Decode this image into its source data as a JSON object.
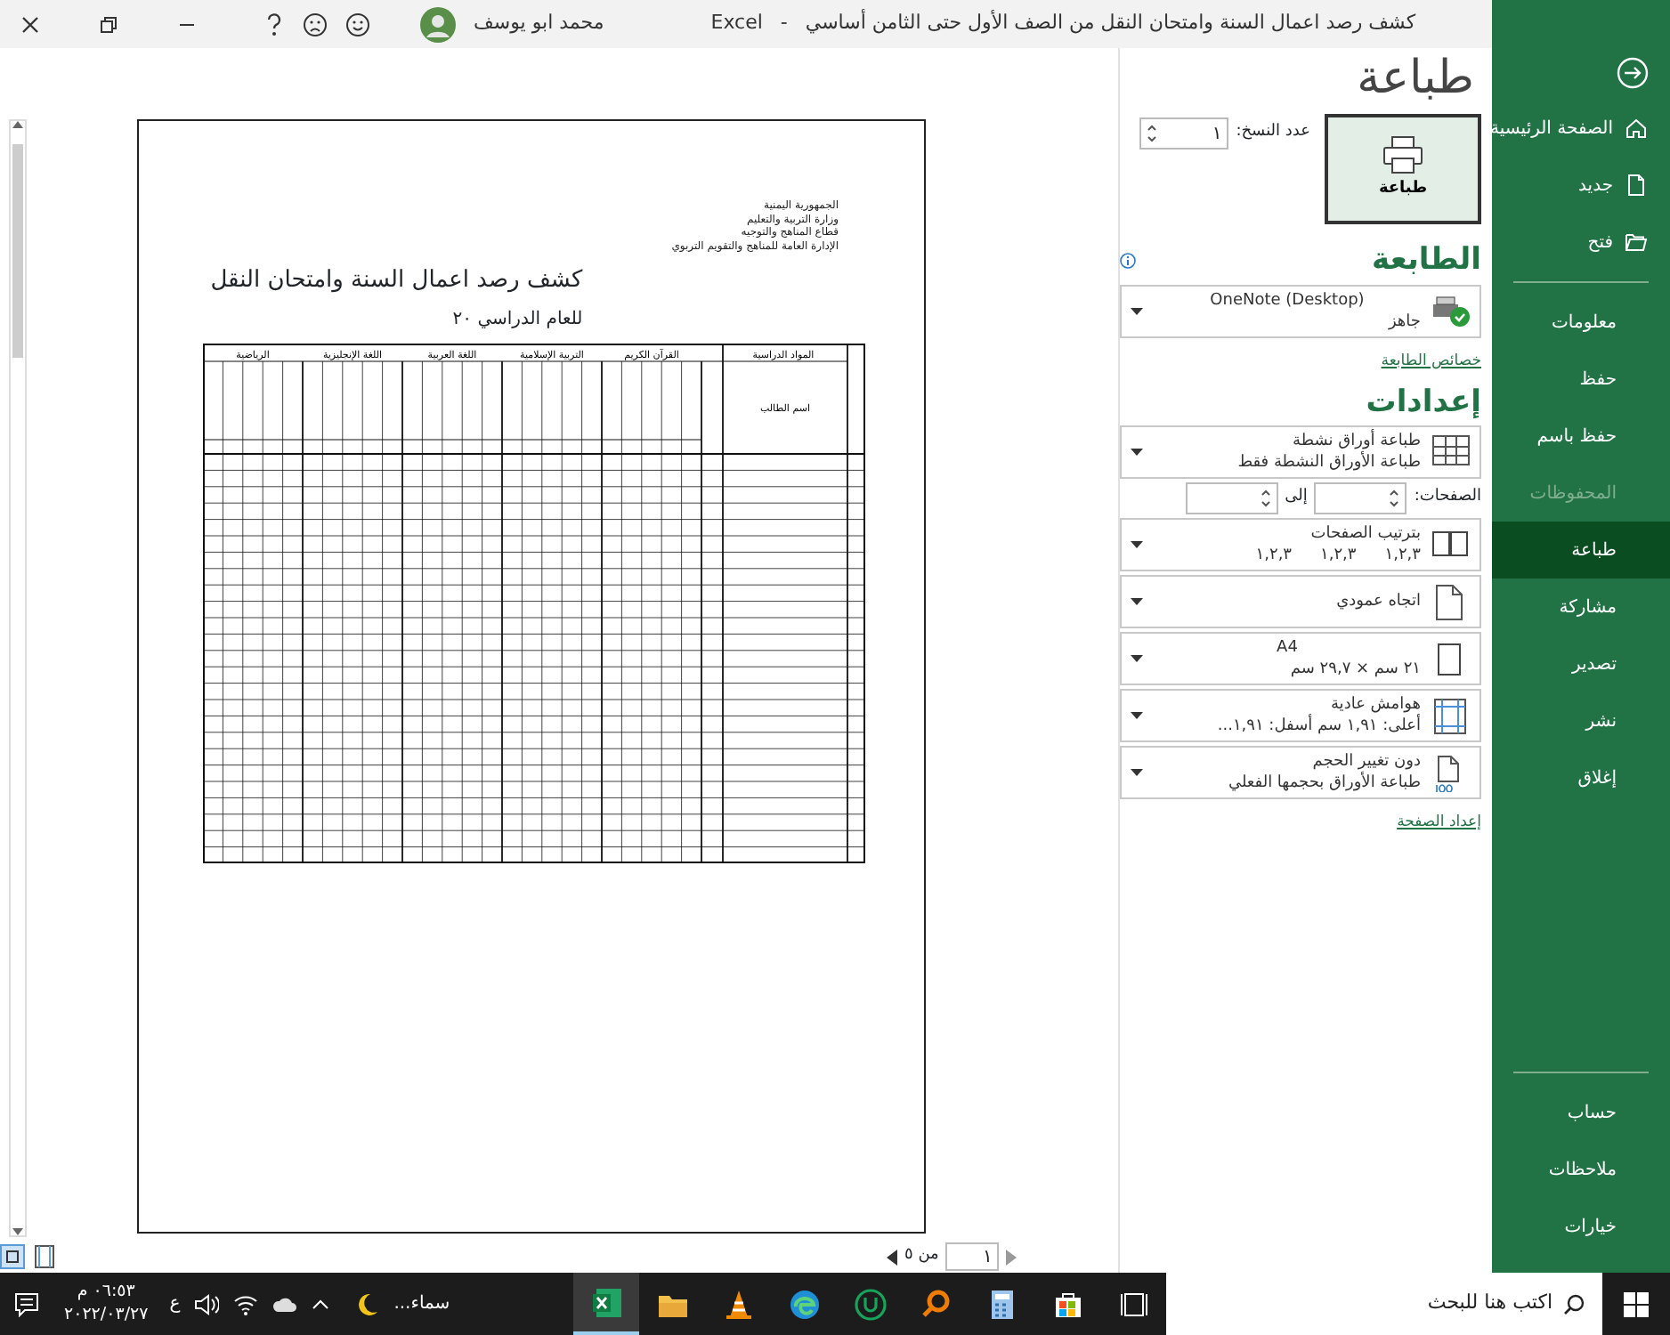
{
  "title_bar": {
    "document_title": "كشف رصد اعمال السنة وامتحان النقل من الصف الأول حتى الثامن أساسي",
    "separator": "-",
    "app": "Excel",
    "user": "محمد ابو يوسف"
  },
  "sidebar": {
    "top_items": [
      {
        "kind": "home",
        "label": "الصفحة الرئيسية",
        "selected": false
      },
      {
        "kind": "new",
        "label": "جديد",
        "selected": false
      },
      {
        "kind": "open",
        "label": "فتح",
        "selected": false
      }
    ],
    "items": [
      {
        "label": "معلومات",
        "selected": false,
        "disabled": false
      },
      {
        "label": "حفظ",
        "selected": false,
        "disabled": false
      },
      {
        "label": "حفظ باسم",
        "selected": false,
        "disabled": false
      },
      {
        "label": "المحفوظات",
        "selected": false,
        "disabled": true
      },
      {
        "label": "طباعة",
        "selected": true,
        "disabled": false
      },
      {
        "label": "مشاركة",
        "selected": false,
        "disabled": false
      },
      {
        "label": "تصدير",
        "selected": false,
        "disabled": false
      },
      {
        "label": "نشر",
        "selected": false,
        "disabled": false
      },
      {
        "label": "إغلاق",
        "selected": false,
        "disabled": false
      }
    ],
    "bottom_items": [
      {
        "label": "حساب",
        "selected": false
      },
      {
        "label": "ملاحظات",
        "selected": false
      },
      {
        "label": "خيارات",
        "selected": false
      }
    ]
  },
  "print": {
    "heading": "طباعة",
    "button": "طباعة",
    "copies_label": "عدد النسخ:",
    "copies_value": "١"
  },
  "printer": {
    "heading": "الطابعة",
    "name": "OneNote (Desktop)",
    "status": "جاهز",
    "properties_link": "خصائص الطابعة"
  },
  "settings": {
    "heading": "إعدادات",
    "pages_label": "الصفحات:",
    "to_label": "إلى",
    "page_setup_link": "إعداد الصفحة",
    "options": [
      {
        "kind": "sheets",
        "title": "طباعة أوراق نشطة",
        "subtitle": "طباعة الأوراق النشطة فقط"
      },
      {
        "kind": "pages"
      },
      {
        "kind": "collation",
        "title": "بترتيب الصفحات",
        "subtitle_parts": [
          "١,٢,٣",
          "١,٢,٣",
          "١,٢,٣"
        ]
      },
      {
        "kind": "orientation",
        "title": "اتجاه عمودي"
      },
      {
        "kind": "paper",
        "title": "A4",
        "subtitle": "٢١ سم × ٢٩,٧ سم"
      },
      {
        "kind": "margins",
        "title": "هوامش عادية",
        "subtitle": "أعلى: ١,٩١ سم أسفل: ١,٩١..."
      },
      {
        "kind": "scaling",
        "title": "دون تغيير الحجم",
        "subtitle": "طباعة الأوراق بحجمها الفعلي"
      }
    ]
  },
  "preview": {
    "header_lines": [
      "الجمهورية اليمنية",
      "وزارة التربية والتعليم",
      "قطاع المناهج والتوجيه",
      "الإدارة العامة للمناهج والتقويم التربوي"
    ],
    "title": "كشف رصد اعمال السنة وامتحان النقل",
    "year": "للعام الدراسي ٢٠",
    "table": {
      "subjects": [
        "القرآن الكريم",
        "التربية الإسلامية",
        "اللغة العربية",
        "اللغة الإنجليزية",
        "الرياضية"
      ],
      "subjects_label": "المواد الدراسية",
      "name_label": "اسم الطالب"
    },
    "page_value": "١",
    "page_total": "من ٥"
  },
  "taskbar": {
    "search_placeholder": "اكتب هنا للبحث",
    "weather": "سماء...",
    "language": "ع",
    "time": "٠٦:٥٣ م",
    "date": "٢٠٢٢/٠٣/٢٧",
    "apps": [
      {
        "kind": "taskview",
        "selected": false
      },
      {
        "kind": "store",
        "selected": false
      },
      {
        "kind": "calculator",
        "selected": false
      },
      {
        "kind": "search",
        "selected": false
      },
      {
        "kind": "circle",
        "selected": false
      },
      {
        "kind": "browser",
        "selected": false
      },
      {
        "kind": "cone",
        "selected": false
      },
      {
        "kind": "folder",
        "selected": false
      },
      {
        "kind": "excel",
        "selected": true
      }
    ]
  }
}
